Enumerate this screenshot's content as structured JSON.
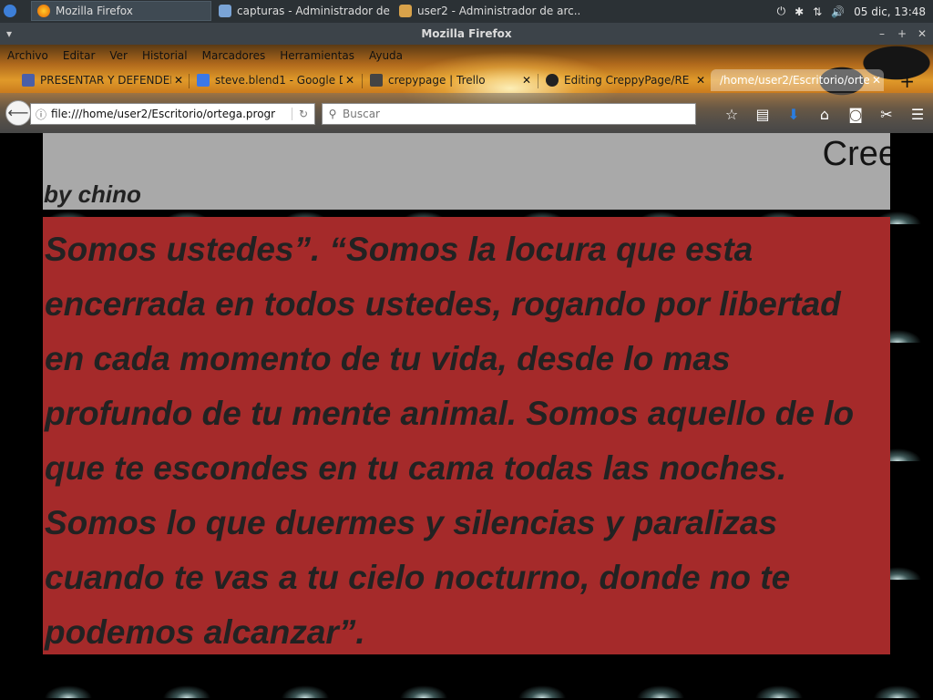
{
  "taskbar": {
    "tasks": [
      {
        "label": "Mozilla Firefox"
      },
      {
        "label": "capturas - Administrador de ..."
      },
      {
        "label": "user2 - Administrador de arc..."
      }
    ],
    "clock": "05 dic, 13:48"
  },
  "window": {
    "title": "Mozilla Firefox"
  },
  "menubar": {
    "items": [
      "Archivo",
      "Editar",
      "Ver",
      "Historial",
      "Marcadores",
      "Herramientas",
      "Ayuda"
    ]
  },
  "tabs": [
    {
      "label": "PRESENTAR Y DEFENDER"
    },
    {
      "label": "steve.blend1 - Google D"
    },
    {
      "label": "crepypage | Trello"
    },
    {
      "label": "Editing CreppyPage/RE"
    },
    {
      "label": "/home/user2/Escritorio/orte"
    }
  ],
  "navbar": {
    "url": "file:///home/user2/Escritorio/ortega.progr",
    "search_placeholder": "Buscar"
  },
  "page": {
    "title": "Cree",
    "byline": "by chino",
    "story": "Somos ustedes”. “Somos la locura que esta encerrada en todos ustedes, rogando por libertad en cada momento de tu vida, desde lo mas profundo de tu mente animal. Somos aquello de lo que te escondes en tu cama todas las noches. Somos lo que duermes y silencias y paralizas cuando te vas a tu cielo nocturno, donde no te podemos alcanzar”."
  },
  "colors": {
    "header_bg": "#a9a9a9",
    "story_bg": "#a52a2a",
    "text": "#222222"
  }
}
